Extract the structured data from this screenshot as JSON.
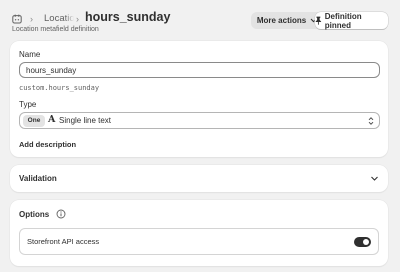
{
  "header": {
    "breadcrumb_icon": "metafield-icon",
    "breadcrumb_link": "Location metafields",
    "title": "hours_sunday",
    "subtitle": "Location metafield definition",
    "more_actions_label": "More actions",
    "pinned_label": "Definition pinned"
  },
  "main": {
    "name_label": "Name",
    "name_value": "hours_sunday",
    "namespace_key": "custom.hours_sunday",
    "type_label": "Type",
    "type_badge": "One",
    "type_icon_glyph": "A",
    "type_value": "Single line text",
    "add_description_label": "Add description"
  },
  "validation": {
    "title": "Validation"
  },
  "options": {
    "title": "Options",
    "storefront_label": "Storefront API access",
    "storefront_enabled": true
  }
}
